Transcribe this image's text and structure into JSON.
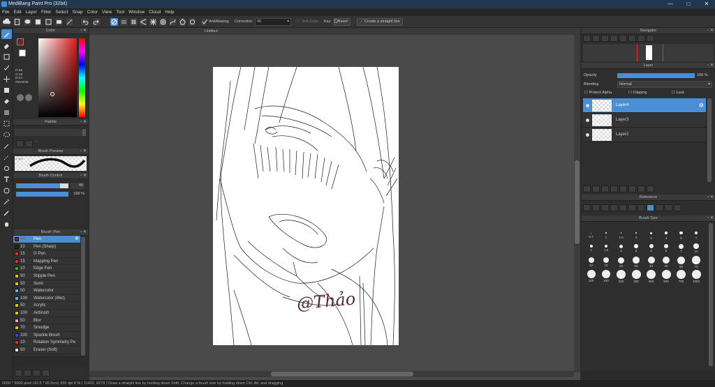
{
  "window": {
    "title": "MediBang Paint Pro (32bit)",
    "min": "—",
    "max": "□",
    "close": "✕"
  },
  "menu": [
    "File",
    "Edit",
    "Layer",
    "Filter",
    "Select",
    "Snap",
    "Color",
    "View",
    "Tool",
    "Window",
    "Cloud",
    "Help"
  ],
  "toolbar": {
    "antialiasing": "AntiAliasing",
    "correction_label": "Correction",
    "correction_value": "40",
    "soft_edge": "Soft Edge",
    "key": "Key",
    "reset": "Reset",
    "straight_line": "Create a straight line"
  },
  "color_panel": {
    "title": "Color",
    "r": "R:88",
    "g": "G:50",
    "b": "B:54",
    "hex": "#583036",
    "fg": "#7a1f24",
    "bg": "#ffffff"
  },
  "palette_panel": {
    "title": "Palette"
  },
  "brush_preview": {
    "title": "Brush Preview",
    "size": "2.4px"
  },
  "brush_control": {
    "title": "Brush Control",
    "size_value": "40",
    "opacity_value": "100 %"
  },
  "brush_panel": {
    "title": "Brush: Pen",
    "items": [
      {
        "size": "40",
        "name": "Pen",
        "color": "#7a1f24"
      },
      {
        "size": "10",
        "name": "Pen (Sharp)",
        "color": "#222222"
      },
      {
        "size": "15",
        "name": "G Pen",
        "color": "#e03030"
      },
      {
        "size": "15",
        "name": "Mapping Pen",
        "color": "#e03030"
      },
      {
        "size": "10",
        "name": "Edge Pen",
        "color": "#30b030"
      },
      {
        "size": "50",
        "name": "Stipple Pen",
        "color": "#e0c020"
      },
      {
        "size": "50",
        "name": "Sumi",
        "color": "#e0c020"
      },
      {
        "size": "50",
        "name": "Watercolor",
        "color": "#50b8f0"
      },
      {
        "size": "100",
        "name": "Watercolor (Wet)",
        "color": "#50b8f0"
      },
      {
        "size": "50",
        "name": "Acrylic",
        "color": "#e0c020"
      },
      {
        "size": "100",
        "name": "Airbrush",
        "color": "#e0c020"
      },
      {
        "size": "50",
        "name": "Blur",
        "color": "#f0a0c0"
      },
      {
        "size": "70",
        "name": "Smudge",
        "color": "#e0c020"
      },
      {
        "size": "100",
        "name": "Sparkle Brush",
        "color": "#3050e0"
      },
      {
        "size": "10",
        "name": "Rotation Symmetry Pe",
        "color": "#e03030"
      },
      {
        "size": "50",
        "name": "Eraser (Soft)",
        "color": "#ffffff"
      },
      {
        "size": "50",
        "name": "Eraser",
        "color": "#ffffff"
      }
    ]
  },
  "document": {
    "tab": "Untitled",
    "signature": "@Thảo"
  },
  "navigator": {
    "title": "Navigator"
  },
  "layer_panel": {
    "title": "Layer",
    "opacity_label": "Opacity",
    "opacity_value": "100 %",
    "opacity": 100,
    "blending_label": "Blending",
    "blending_value": "Normal",
    "protect_alpha": "Protect Alpha",
    "clipping": "Clipping",
    "lock": "Lock",
    "layers": [
      {
        "name": "Layer4",
        "selected": true
      },
      {
        "name": "Layer3",
        "selected": false
      },
      {
        "name": "Layer2",
        "selected": false
      }
    ]
  },
  "reference": {
    "title": "Reference"
  },
  "brush_size": {
    "title": "Brush Size",
    "sizes": [
      "0.7",
      "0.7",
      "1",
      "1.5",
      "2",
      "3",
      "4",
      "5",
      "7",
      "1",
      "1.5",
      "2",
      "3",
      "4",
      "5",
      "7",
      "10",
      "12",
      "15",
      "20",
      "25",
      "30",
      "40",
      "50",
      "70",
      "100",
      "150",
      "200",
      "300",
      "400",
      "500",
      "700",
      "1000"
    ]
  },
  "status": "5000 * 9000 pixel  (43.5 * 65.5cm)  350 dpi  8 %  ( 11422, 8279 )  Draw a straight line by holding down Shift, Change a brush size by holding down Ctrl, Alt, and dragging"
}
